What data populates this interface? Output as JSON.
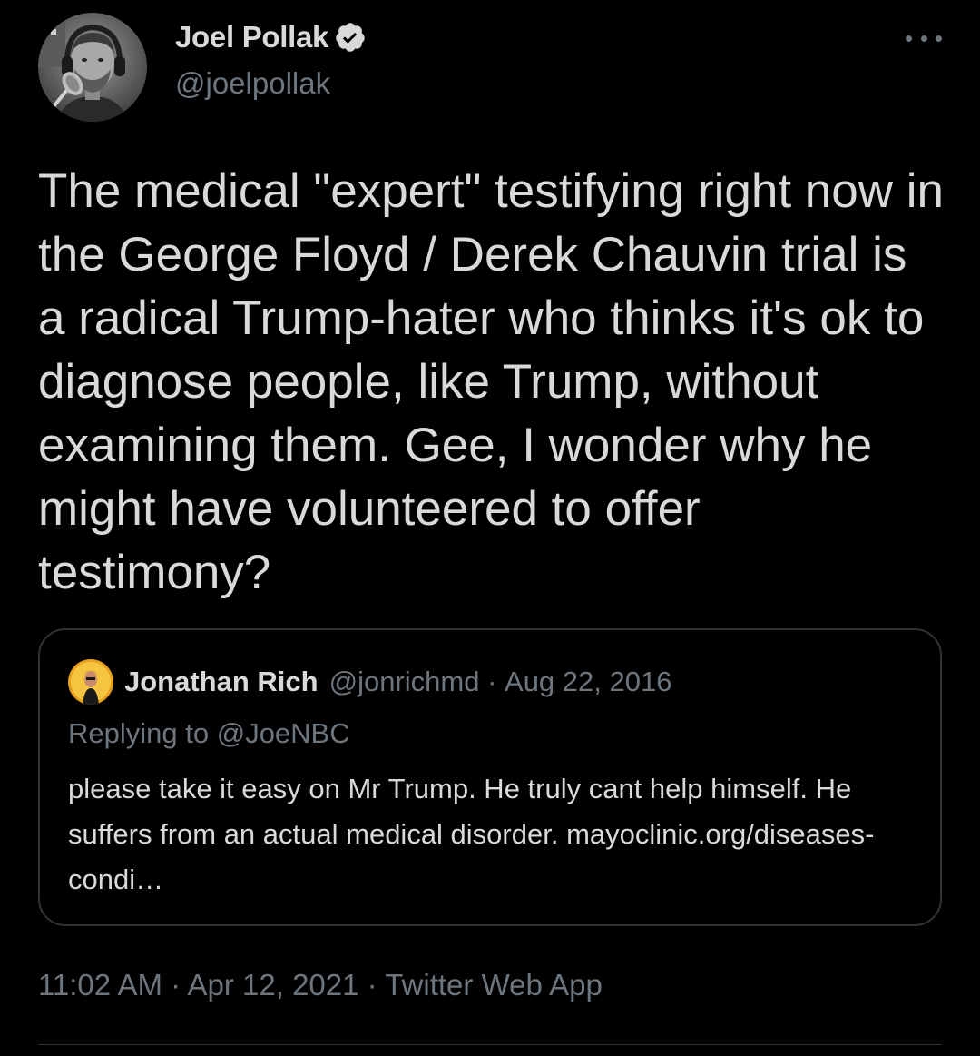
{
  "author": {
    "name": "Joel Pollak",
    "handle": "@joelpollak",
    "verified": true
  },
  "more_icon": "more-horizontal-icon",
  "tweet": {
    "text": "The medical \"expert\" testifying right now in the George Floyd / Derek Chauvin trial is a radical Trump-hater who thinks it's ok to diagnose people, like Trump, without examining them. Gee, I wonder why he might have volunteered to offer testimony?"
  },
  "quoted": {
    "name": "Jonathan Rich",
    "handle": "@jonrichmd",
    "separator": " · ",
    "date": "Aug 22, 2016",
    "replying_prefix": "Replying to ",
    "replying_to": "@JoeNBC",
    "text": "please take it easy on Mr Trump. He truly cant help himself. He suffers from an actual medical disorder. mayoclinic.org/diseases-condi…"
  },
  "meta": {
    "time": "11:02 AM",
    "sep1": " · ",
    "date": "Apr 12, 2021",
    "sep2": " · ",
    "source": "Twitter Web App"
  },
  "colors": {
    "background": "#000000",
    "text_primary": "#d9d9d9",
    "text_secondary": "#6e767d",
    "border": "#2f3336",
    "verified_badge": "#d9d9d9"
  }
}
